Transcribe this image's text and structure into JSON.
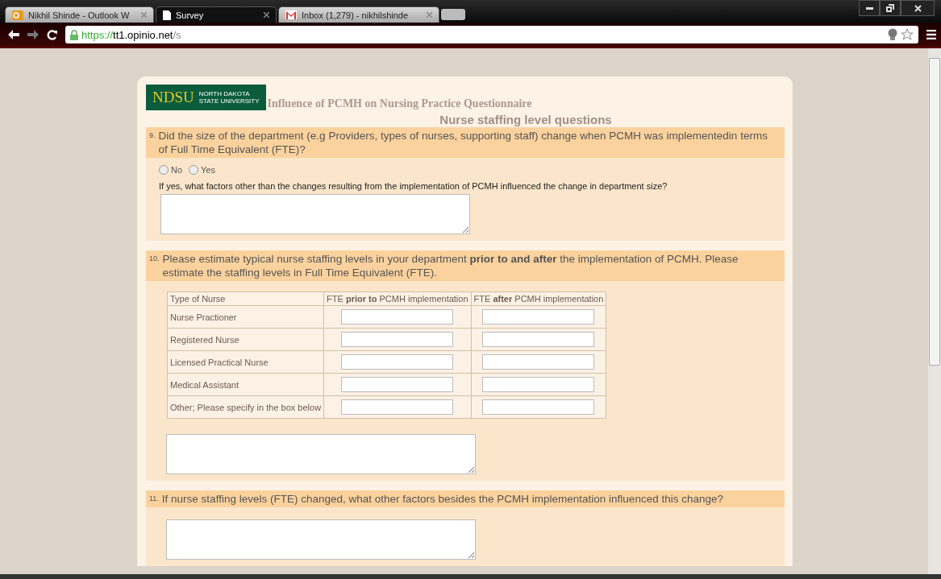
{
  "browser": {
    "tabs": [
      {
        "label": "Nikhil Shinde - Outlook W",
        "selected": false
      },
      {
        "label": "Survey",
        "selected": true
      },
      {
        "label": "Inbox (1,279) - nikhilshinde",
        "selected": false
      }
    ],
    "url": {
      "scheme": "https://",
      "host": "tt1.opinio.net",
      "path": "/s"
    }
  },
  "survey": {
    "logo": {
      "mark": "NDSU",
      "line1": "NORTH DAKOTA",
      "line2": "STATE UNIVERSITY"
    },
    "title": "Influence of PCMH on Nursing Practice Questionnaire",
    "section": "Nurse staffing level questions",
    "questions": [
      {
        "kind": "radio",
        "number": "9.",
        "text": "Did the size of the department (e.g Providers, types of nurses, supporting staff) change when PCMH was implementedin terms of Full Time Equivalent (FTE)?",
        "options": [
          {
            "label": "No",
            "selected": false
          },
          {
            "label": "Yes",
            "selected": false
          }
        ],
        "followup": "If yes, what factors other than the changes resulting from the implementation of PCMH influenced the change in department size?"
      },
      {
        "kind": "table",
        "number": "10.",
        "text": "Please estimate typical nurse staffing levels in your department **prior to and after** the implementation of PCMH. Please estimate the staffing levels in Full Time Equivalent (FTE).",
        "columns": [
          "Type of Nurse",
          "FTE **prior to** PCMH implementation",
          "FTE **after** PCMH implementation"
        ],
        "rows": [
          "Nurse Practioner",
          "Registered Nurse",
          "Licensed Practical Nurse",
          "Medical Assistant",
          "Other; Please specify in the box below"
        ]
      },
      {
        "kind": "text",
        "number": "11.",
        "text": "If nurse staffing levels (FTE) changed, what other factors besides the PCMH implementation influenced this change?"
      }
    ]
  }
}
